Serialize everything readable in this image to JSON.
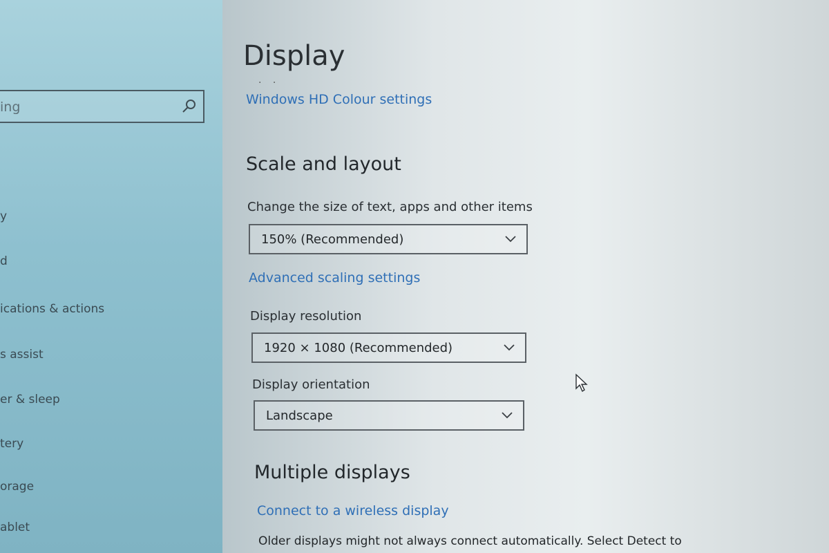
{
  "sidebar": {
    "search": {
      "value": "ing"
    },
    "items": [
      {
        "label": "y"
      },
      {
        "label": "d"
      },
      {
        "label": "ications & actions"
      },
      {
        "label": "s assist"
      },
      {
        "label": "er & sleep"
      },
      {
        "label": "tery"
      },
      {
        "label": "orage"
      },
      {
        "label": "ablet"
      }
    ]
  },
  "main": {
    "title": "Display",
    "dots": ". .",
    "hd_colour_link": "Windows HD Colour settings",
    "scale_layout": {
      "heading": "Scale and layout",
      "size_label": "Change the size of text, apps and other items",
      "size_value": "150% (Recommended)",
      "advanced_link": "Advanced scaling settings",
      "resolution_label": "Display resolution",
      "resolution_value": "1920 × 1080 (Recommended)",
      "orientation_label": "Display orientation",
      "orientation_value": "Landscape"
    },
    "multiple_displays": {
      "heading": "Multiple displays",
      "wireless_link": "Connect to a wireless display",
      "description": "Older displays might not always connect automatically. Select Detect to"
    }
  },
  "icons": {
    "search": "search-icon",
    "chevron": "chevron-down-icon",
    "cursor": "mouse-pointer-icon"
  },
  "colors": {
    "link": "#2f6fb6",
    "sidebar": "#8ec0cf"
  }
}
